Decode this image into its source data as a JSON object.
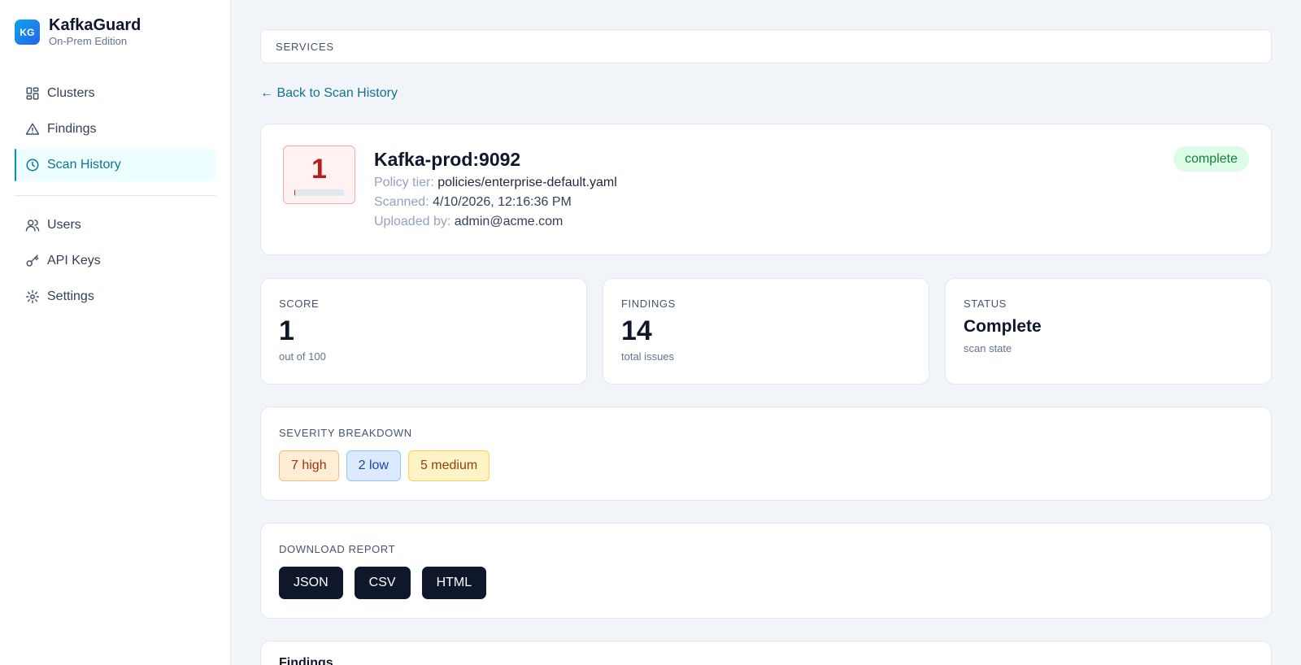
{
  "brand": {
    "logo_text": "KG",
    "name": "KafkaGuard",
    "edition": "On-Prem Edition"
  },
  "nav": {
    "primary": [
      {
        "label": "Clusters",
        "icon": "grid-icon"
      },
      {
        "label": "Findings",
        "icon": "alert-triangle-icon"
      },
      {
        "label": "Scan History",
        "icon": "clock-icon",
        "active": true
      }
    ],
    "secondary": [
      {
        "label": "Users",
        "icon": "users-icon"
      },
      {
        "label": "API Keys",
        "icon": "key-icon"
      },
      {
        "label": "Settings",
        "icon": "gear-icon"
      }
    ]
  },
  "breadcrumb": "SERVICES",
  "back_link": "← Back to Scan History",
  "scan": {
    "score": "1",
    "score_fraction": 0.01,
    "title": "Kafka-prod:9092",
    "policy_label": "Policy tier:",
    "policy_value": "policies/enterprise-default.yaml",
    "scanned_label": "Scanned:",
    "scanned_value": "4/10/2026, 12:16:36 PM",
    "uploaded_label": "Uploaded by:",
    "uploaded_value": "admin@acme.com",
    "status_pill": "complete"
  },
  "stats": {
    "score": {
      "label": "SCORE",
      "value": "1",
      "sub": "out of 100"
    },
    "findings": {
      "label": "FINDINGS",
      "value": "14",
      "sub": "total issues"
    },
    "status": {
      "label": "STATUS",
      "value": "Complete",
      "sub": "scan state"
    }
  },
  "severity": {
    "label": "SEVERITY BREAKDOWN",
    "high": "7 high",
    "low": "2 low",
    "medium": "5 medium"
  },
  "download": {
    "label": "DOWNLOAD REPORT",
    "json": "JSON",
    "csv": "CSV",
    "html": "HTML"
  },
  "findings_section": {
    "title": "Findings"
  },
  "colors": {
    "accent": "#0e7490",
    "score_critical": "#b91c1c",
    "status_complete": "#15803d",
    "button_dark": "#0f172a"
  }
}
